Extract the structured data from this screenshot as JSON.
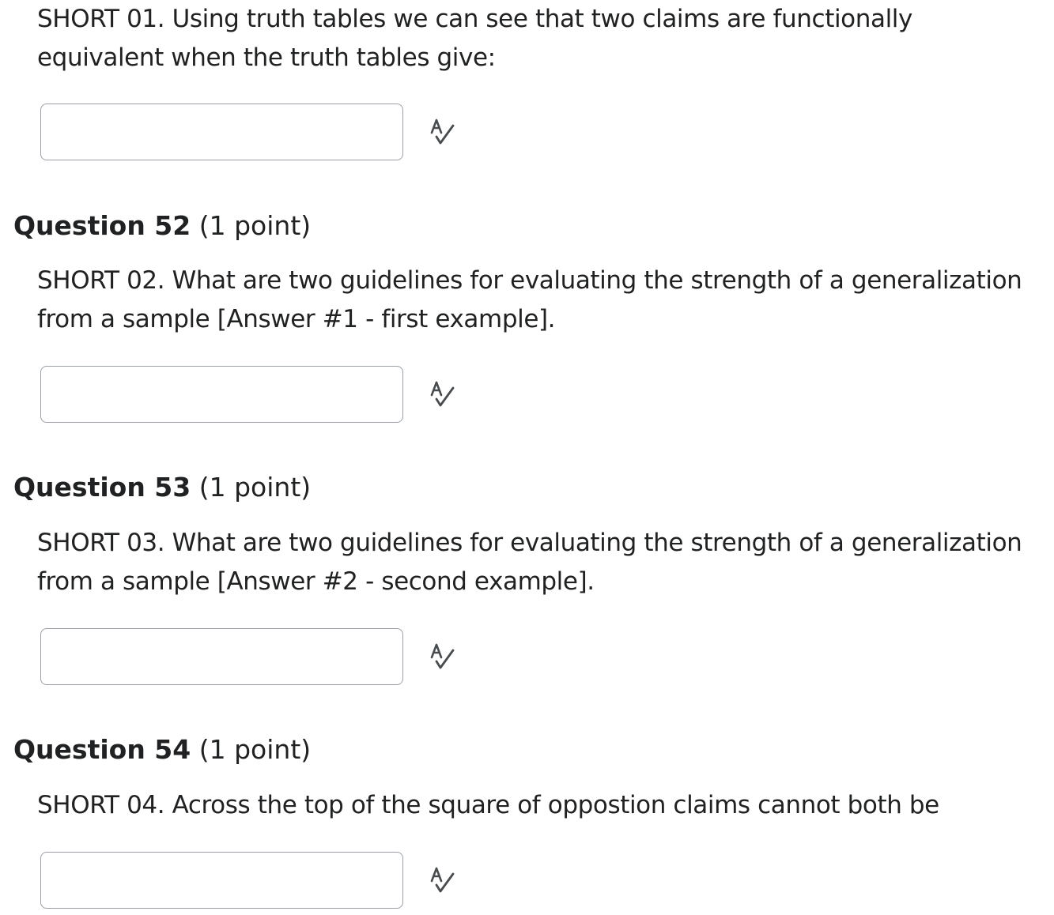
{
  "questions": [
    {
      "prompt": "SHORT 01. Using truth tables we can see that two claims are functionally equivalent when the truth tables give:",
      "answer_value": "",
      "spellcheck_icon": "spellcheck-icon"
    },
    {
      "title": "Question 52",
      "points": "(1 point)",
      "prompt": "SHORT 02. What are two guidelines for evaluating the strength of a generalization from a sample [Answer #1 - first example].",
      "answer_value": "",
      "spellcheck_icon": "spellcheck-icon"
    },
    {
      "title": "Question 53",
      "points": "(1 point)",
      "prompt": "SHORT 03. What are two guidelines for evaluating the strength of a generalization from a sample [Answer #2 - second example].",
      "answer_value": "",
      "spellcheck_icon": "spellcheck-icon"
    },
    {
      "title": "Question 54",
      "points": "(1 point)",
      "prompt": "SHORT 04. Across the top of the square of oppostion claims cannot both be",
      "answer_value": "",
      "spellcheck_icon": "spellcheck-icon"
    }
  ],
  "colors": {
    "text": "#202122",
    "input_border": "#9aa0a6",
    "icon": "#494c4e"
  }
}
